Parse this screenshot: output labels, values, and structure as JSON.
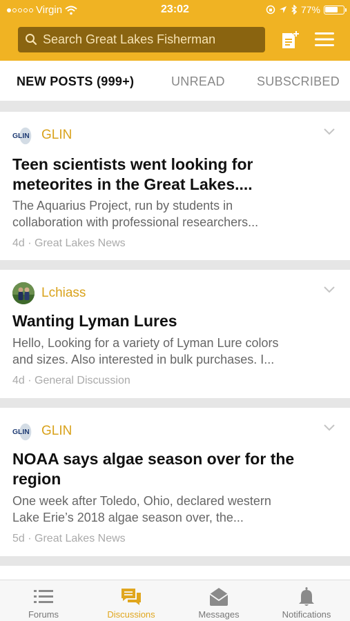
{
  "status_bar": {
    "carrier": "Virgin",
    "time": "23:02",
    "battery": "77%",
    "battery_level": 0.77
  },
  "search": {
    "placeholder": "Search Great Lakes Fisherman"
  },
  "tabs": [
    {
      "label": "NEW POSTS (999+)",
      "active": true
    },
    {
      "label": "UNREAD",
      "active": false
    },
    {
      "label": "SUBSCRIBED",
      "active": false
    }
  ],
  "posts": [
    {
      "avatar_text": "GLIN",
      "author": "GLIN",
      "title_lines": [
        "Teen scientists went looking for",
        "meteorites in the Great Lakes...."
      ],
      "excerpt_lines": [
        "The Aquarius Project, run by students in",
        "collaboration with professional researchers..."
      ],
      "age": "4d",
      "separator": "·",
      "forum": "Great Lakes News"
    },
    {
      "avatar_text": "",
      "author": "Lchiass",
      "title_lines": [
        "Wanting Lyman Lures"
      ],
      "excerpt_lines": [
        "Hello, Looking for a variety of Lyman Lure colors",
        "and sizes. Also interested in bulk purchases. I..."
      ],
      "age": "4d",
      "separator": "·",
      "forum": "General Discussion"
    },
    {
      "avatar_text": "GLIN",
      "author": "GLIN",
      "title_lines": [
        "NOAA says algae season over for the",
        "region"
      ],
      "excerpt_lines": [
        "One week after Toledo, Ohio, declared western",
        "Lake Erie’s 2018 algae season over, the..."
      ],
      "age": "5d",
      "separator": "·",
      "forum": "Great Lakes News"
    }
  ],
  "tabbar": [
    {
      "label": "Forums",
      "icon": "list-icon",
      "active": false
    },
    {
      "label": "Discussions",
      "icon": "chat-bubbles-icon",
      "active": true
    },
    {
      "label": "Messages",
      "icon": "envelope-icon",
      "active": false
    },
    {
      "label": "Notifications",
      "icon": "bell-icon",
      "active": false
    }
  ],
  "colors": {
    "accent": "#f0b323",
    "author": "#d9a21b",
    "search_bg": "#8a6410",
    "active_tab_icon": "#e0a61e"
  }
}
